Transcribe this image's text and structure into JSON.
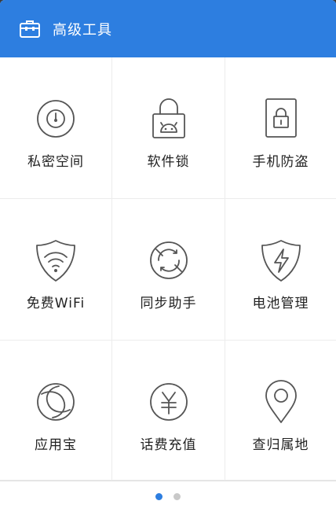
{
  "header": {
    "title": "高级工具",
    "icon": "toolbox-icon"
  },
  "tools": [
    {
      "label": "私密空间",
      "icon": "clock-lock-icon"
    },
    {
      "label": "软件锁",
      "icon": "android-lock-icon"
    },
    {
      "label": "手机防盗",
      "icon": "phone-lock-icon"
    },
    {
      "label": "免费WiFi",
      "icon": "wifi-shield-icon"
    },
    {
      "label": "同步助手",
      "icon": "sync-icon"
    },
    {
      "label": "电池管理",
      "icon": "battery-shield-icon"
    },
    {
      "label": "应用宝",
      "icon": "app-store-icon"
    },
    {
      "label": "话费充值",
      "icon": "yen-icon"
    },
    {
      "label": "查归属地",
      "icon": "location-pin-icon"
    }
  ],
  "pager": {
    "total": 2,
    "current": 1
  },
  "colors": {
    "accent": "#2d7ee0",
    "icon": "#555555"
  }
}
